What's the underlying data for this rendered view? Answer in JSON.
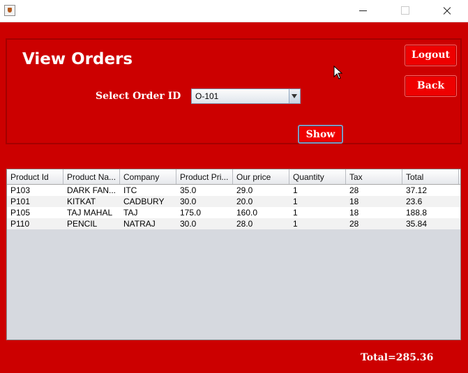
{
  "window": {
    "icon": "java-cup-icon",
    "controls": [
      "minimize-icon",
      "maximize-icon",
      "close-icon"
    ]
  },
  "header": {
    "title": "View Orders",
    "select_label": "Select Order ID",
    "order_id": "O-101"
  },
  "buttons": {
    "logout": "Logout",
    "back": "Back",
    "show": "Show"
  },
  "table": {
    "columns": [
      "Product Id",
      "Product Na...",
      "Company",
      "Product Pri...",
      "Our price",
      "Quantity",
      "Tax",
      "Total"
    ],
    "rows": [
      [
        "P103",
        "DARK FAN...",
        "ITC",
        "35.0",
        "29.0",
        "1",
        "28",
        "37.12"
      ],
      [
        "P101",
        "KITKAT",
        "CADBURY",
        "30.0",
        "20.0",
        "1",
        "18",
        "23.6"
      ],
      [
        "P105",
        "TAJ MAHAL",
        "TAJ",
        "175.0",
        "160.0",
        "1",
        "18",
        "188.8"
      ],
      [
        "P110",
        "PENCIL",
        "NATRAJ",
        "30.0",
        "28.0",
        "1",
        "28",
        "35.84"
      ]
    ]
  },
  "footer": {
    "total": "Total=285.36"
  },
  "colors": {
    "background": "#cc0000",
    "button": "#ee0000",
    "table_empty": "#d6d9df"
  }
}
